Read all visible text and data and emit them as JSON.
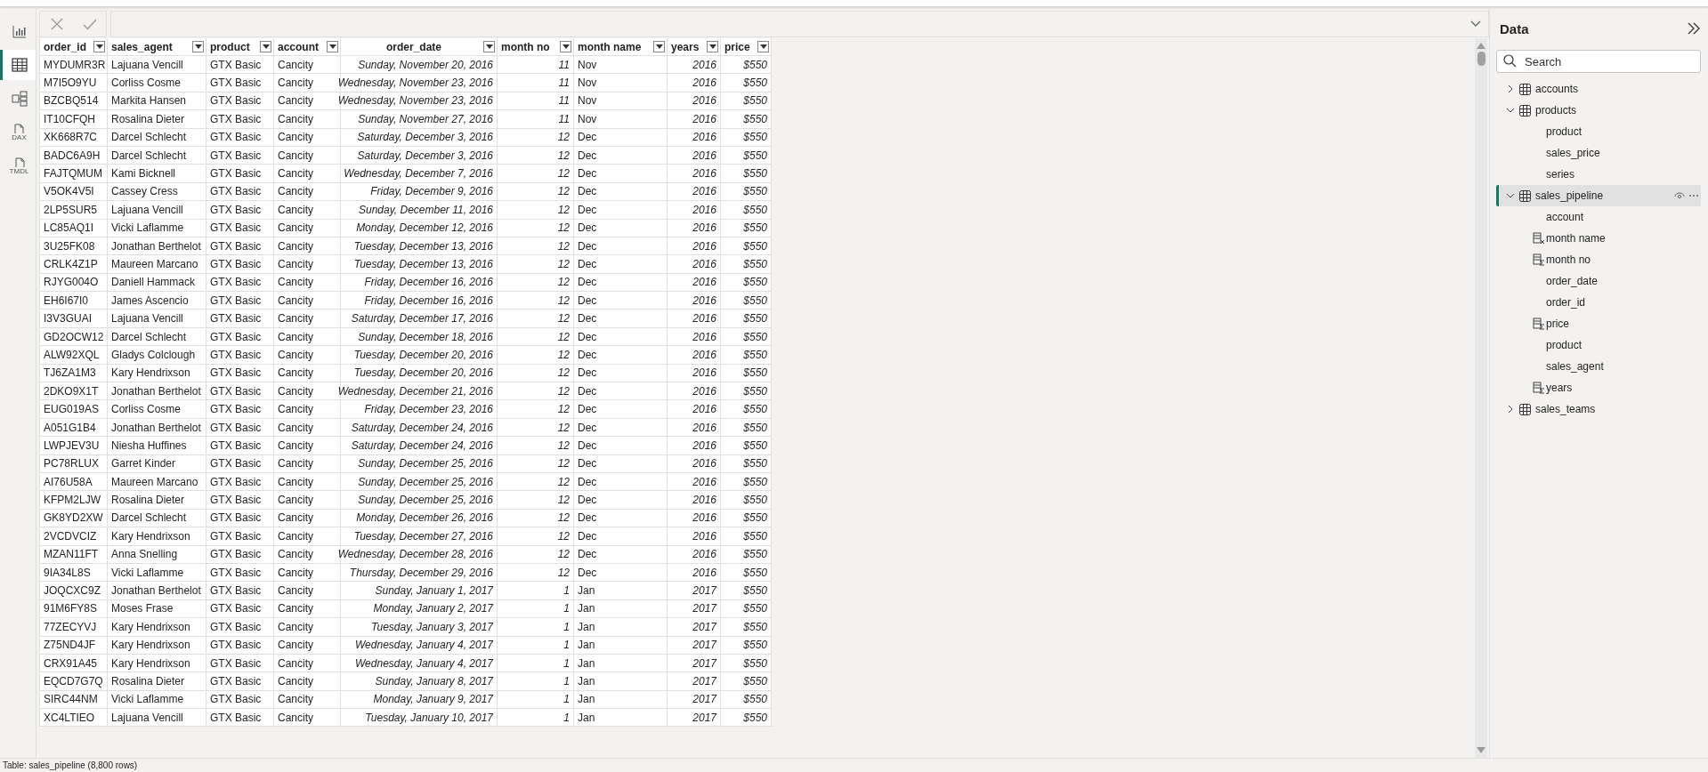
{
  "rail": [
    {
      "kind": "report",
      "selected": false
    },
    {
      "kind": "table",
      "selected": true
    },
    {
      "kind": "model",
      "selected": false
    },
    {
      "kind": "doc",
      "label": "DAX",
      "selected": false
    },
    {
      "kind": "doc",
      "label": "TMDL",
      "selected": false
    }
  ],
  "table": {
    "columns": [
      {
        "name": "order_id",
        "kind": "text"
      },
      {
        "name": "sales_agent",
        "kind": "text"
      },
      {
        "name": "product",
        "kind": "text"
      },
      {
        "name": "account",
        "kind": "text"
      },
      {
        "name": "order_date",
        "kind": "number"
      },
      {
        "name": "month no",
        "kind": "number"
      },
      {
        "name": "month name",
        "kind": "text"
      },
      {
        "name": "years",
        "kind": "number"
      },
      {
        "name": "price",
        "kind": "number"
      }
    ],
    "rows": [
      [
        "MYDUMR3R",
        "Lajuana Vencill",
        "GTX Basic",
        "Cancity",
        "Sunday, November 20, 2016",
        "11",
        "Nov",
        "2016",
        "$550"
      ],
      [
        "M7I5O9YU",
        "Corliss Cosme",
        "GTX Basic",
        "Cancity",
        "Wednesday, November 23, 2016",
        "11",
        "Nov",
        "2016",
        "$550"
      ],
      [
        "BZCBQ514",
        "Markita Hansen",
        "GTX Basic",
        "Cancity",
        "Wednesday, November 23, 2016",
        "11",
        "Nov",
        "2016",
        "$550"
      ],
      [
        "IT10CFQH",
        "Rosalina Dieter",
        "GTX Basic",
        "Cancity",
        "Sunday, November 27, 2016",
        "11",
        "Nov",
        "2016",
        "$550"
      ],
      [
        "XK668R7C",
        "Darcel Schlecht",
        "GTX Basic",
        "Cancity",
        "Saturday, December 3, 2016",
        "12",
        "Dec",
        "2016",
        "$550"
      ],
      [
        "BADC6A9H",
        "Darcel Schlecht",
        "GTX Basic",
        "Cancity",
        "Saturday, December 3, 2016",
        "12",
        "Dec",
        "2016",
        "$550"
      ],
      [
        "FAJTQMUM",
        "Kami Bicknell",
        "GTX Basic",
        "Cancity",
        "Wednesday, December 7, 2016",
        "12",
        "Dec",
        "2016",
        "$550"
      ],
      [
        "V5OK4V5I",
        "Cassey Cress",
        "GTX Basic",
        "Cancity",
        "Friday, December 9, 2016",
        "12",
        "Dec",
        "2016",
        "$550"
      ],
      [
        "2LP5SUR5",
        "Lajuana Vencill",
        "GTX Basic",
        "Cancity",
        "Sunday, December 11, 2016",
        "12",
        "Dec",
        "2016",
        "$550"
      ],
      [
        "LC85AQ1I",
        "Vicki Laflamme",
        "GTX Basic",
        "Cancity",
        "Monday, December 12, 2016",
        "12",
        "Dec",
        "2016",
        "$550"
      ],
      [
        "3U25FK08",
        "Jonathan Berthelot",
        "GTX Basic",
        "Cancity",
        "Tuesday, December 13, 2016",
        "12",
        "Dec",
        "2016",
        "$550"
      ],
      [
        "CRLK4Z1P",
        "Maureen Marcano",
        "GTX Basic",
        "Cancity",
        "Tuesday, December 13, 2016",
        "12",
        "Dec",
        "2016",
        "$550"
      ],
      [
        "RJYG004O",
        "Daniell Hammack",
        "GTX Basic",
        "Cancity",
        "Friday, December 16, 2016",
        "12",
        "Dec",
        "2016",
        "$550"
      ],
      [
        "EH6I67I0",
        "James Ascencio",
        "GTX Basic",
        "Cancity",
        "Friday, December 16, 2016",
        "12",
        "Dec",
        "2016",
        "$550"
      ],
      [
        "I3V3GUAI",
        "Lajuana Vencill",
        "GTX Basic",
        "Cancity",
        "Saturday, December 17, 2016",
        "12",
        "Dec",
        "2016",
        "$550"
      ],
      [
        "GD2OCW12",
        "Darcel Schlecht",
        "GTX Basic",
        "Cancity",
        "Sunday, December 18, 2016",
        "12",
        "Dec",
        "2016",
        "$550"
      ],
      [
        "ALW92XQL",
        "Gladys Colclough",
        "GTX Basic",
        "Cancity",
        "Tuesday, December 20, 2016",
        "12",
        "Dec",
        "2016",
        "$550"
      ],
      [
        "TJ6ZA1M3",
        "Kary Hendrixson",
        "GTX Basic",
        "Cancity",
        "Tuesday, December 20, 2016",
        "12",
        "Dec",
        "2016",
        "$550"
      ],
      [
        "2DKO9X1T",
        "Jonathan Berthelot",
        "GTX Basic",
        "Cancity",
        "Wednesday, December 21, 2016",
        "12",
        "Dec",
        "2016",
        "$550"
      ],
      [
        "EUG019AS",
        "Corliss Cosme",
        "GTX Basic",
        "Cancity",
        "Friday, December 23, 2016",
        "12",
        "Dec",
        "2016",
        "$550"
      ],
      [
        "A051G1B4",
        "Jonathan Berthelot",
        "GTX Basic",
        "Cancity",
        "Saturday, December 24, 2016",
        "12",
        "Dec",
        "2016",
        "$550"
      ],
      [
        "LWPJEV3U",
        "Niesha Huffines",
        "GTX Basic",
        "Cancity",
        "Saturday, December 24, 2016",
        "12",
        "Dec",
        "2016",
        "$550"
      ],
      [
        "PC78RLUX",
        "Garret Kinder",
        "GTX Basic",
        "Cancity",
        "Sunday, December 25, 2016",
        "12",
        "Dec",
        "2016",
        "$550"
      ],
      [
        "AI76U58A",
        "Maureen Marcano",
        "GTX Basic",
        "Cancity",
        "Sunday, December 25, 2016",
        "12",
        "Dec",
        "2016",
        "$550"
      ],
      [
        "KFPM2LJW",
        "Rosalina Dieter",
        "GTX Basic",
        "Cancity",
        "Sunday, December 25, 2016",
        "12",
        "Dec",
        "2016",
        "$550"
      ],
      [
        "GK8YD2XW",
        "Darcel Schlecht",
        "GTX Basic",
        "Cancity",
        "Monday, December 26, 2016",
        "12",
        "Dec",
        "2016",
        "$550"
      ],
      [
        "2VCDVCIZ",
        "Kary Hendrixson",
        "GTX Basic",
        "Cancity",
        "Tuesday, December 27, 2016",
        "12",
        "Dec",
        "2016",
        "$550"
      ],
      [
        "MZAN11FT",
        "Anna Snelling",
        "GTX Basic",
        "Cancity",
        "Wednesday, December 28, 2016",
        "12",
        "Dec",
        "2016",
        "$550"
      ],
      [
        "9IA34L8S",
        "Vicki Laflamme",
        "GTX Basic",
        "Cancity",
        "Thursday, December 29, 2016",
        "12",
        "Dec",
        "2016",
        "$550"
      ],
      [
        "JOQCXC9Z",
        "Jonathan Berthelot",
        "GTX Basic",
        "Cancity",
        "Sunday, January 1, 2017",
        "1",
        "Jan",
        "2017",
        "$550"
      ],
      [
        "91M6FY8S",
        "Moses Frase",
        "GTX Basic",
        "Cancity",
        "Monday, January 2, 2017",
        "1",
        "Jan",
        "2017",
        "$550"
      ],
      [
        "77ZECYVJ",
        "Kary Hendrixson",
        "GTX Basic",
        "Cancity",
        "Tuesday, January 3, 2017",
        "1",
        "Jan",
        "2017",
        "$550"
      ],
      [
        "Z75ND4JF",
        "Kary Hendrixson",
        "GTX Basic",
        "Cancity",
        "Wednesday, January 4, 2017",
        "1",
        "Jan",
        "2017",
        "$550"
      ],
      [
        "CRX91A45",
        "Kary Hendrixson",
        "GTX Basic",
        "Cancity",
        "Wednesday, January 4, 2017",
        "1",
        "Jan",
        "2017",
        "$550"
      ],
      [
        "EQCD7G7Q",
        "Rosalina Dieter",
        "GTX Basic",
        "Cancity",
        "Sunday, January 8, 2017",
        "1",
        "Jan",
        "2017",
        "$550"
      ],
      [
        "SIRC44NM",
        "Vicki Laflamme",
        "GTX Basic",
        "Cancity",
        "Monday, January 9, 2017",
        "1",
        "Jan",
        "2017",
        "$550"
      ],
      [
        "XC4LTIEO",
        "Lajuana Vencill",
        "GTX Basic",
        "Cancity",
        "Tuesday, January 10, 2017",
        "1",
        "Jan",
        "2017",
        "$550"
      ]
    ]
  },
  "data_pane": {
    "title": "Data",
    "search": {
      "placeholder": "Search"
    },
    "tables": [
      {
        "label": "accounts",
        "expanded": false,
        "selected": false
      },
      {
        "label": "products",
        "expanded": true,
        "selected": false,
        "children": [
          {
            "label": "product",
            "kind": "field"
          },
          {
            "label": "sales_price",
            "kind": "field"
          },
          {
            "label": "series",
            "kind": "field"
          }
        ]
      },
      {
        "label": "sales_pipeline",
        "expanded": true,
        "selected": true,
        "children": [
          {
            "label": "account",
            "kind": "field"
          },
          {
            "label": "month name",
            "kind": "calculated"
          },
          {
            "label": "month no",
            "kind": "summed"
          },
          {
            "label": "order_date",
            "kind": "field"
          },
          {
            "label": "order_id",
            "kind": "field"
          },
          {
            "label": "price",
            "kind": "summed"
          },
          {
            "label": "product",
            "kind": "field"
          },
          {
            "label": "sales_agent",
            "kind": "field"
          },
          {
            "label": "years",
            "kind": "summed"
          }
        ]
      },
      {
        "label": "sales_teams",
        "expanded": false,
        "selected": false
      }
    ]
  },
  "status_bar": "Table: sales_pipeline (8,800 rows)"
}
